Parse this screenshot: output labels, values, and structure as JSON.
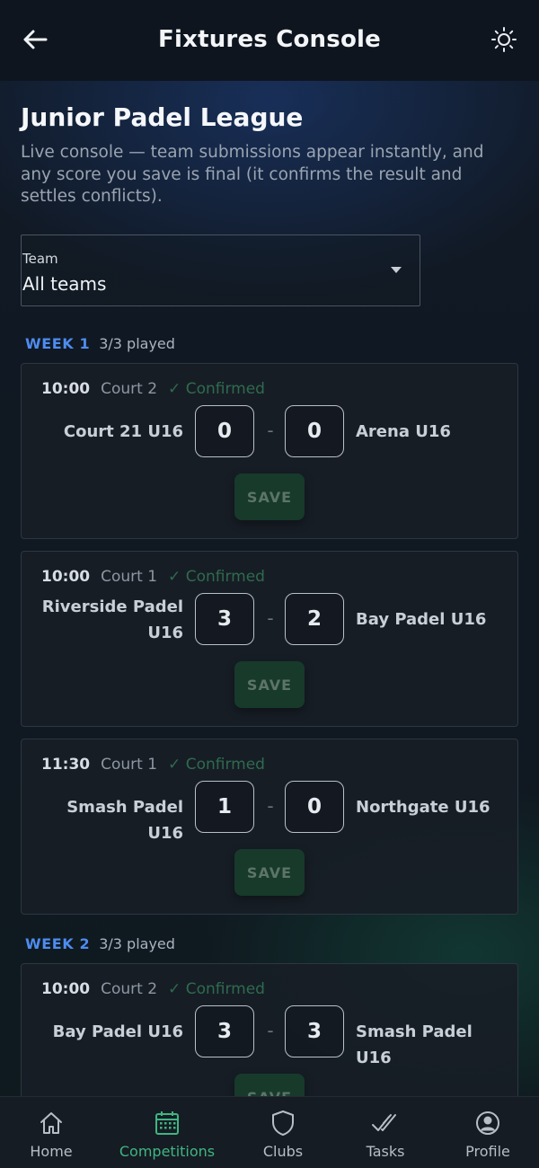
{
  "header": {
    "title": "Fixtures Console"
  },
  "league": {
    "title": "Junior Padel League",
    "description": "Live console — team submissions appear instantly, and any score you save is final (it confirms the result and settles conflicts)."
  },
  "team_filter": {
    "label": "Team",
    "value": "All teams"
  },
  "weeks": [
    {
      "label": "WEEK 1",
      "played": "3/3 played"
    },
    {
      "label": "WEEK 2",
      "played": "3/3 played"
    }
  ],
  "fixtures": [
    {
      "time": "10:00",
      "court": "Court 2",
      "status": "✓ Confirmed",
      "home": "Court 21 U16",
      "home_score": "0",
      "away_score": "0",
      "away": "Arena U16",
      "save": "SAVE"
    },
    {
      "time": "10:00",
      "court": "Court 1",
      "status": "✓ Confirmed",
      "home": "Riverside Padel U16",
      "home_score": "3",
      "away_score": "2",
      "away": "Bay Padel U16",
      "save": "SAVE"
    },
    {
      "time": "11:30",
      "court": "Court 1",
      "status": "✓ Confirmed",
      "home": "Smash Padel U16",
      "home_score": "1",
      "away_score": "0",
      "away": "Northgate U16",
      "save": "SAVE"
    },
    {
      "time": "10:00",
      "court": "Court 2",
      "status": "✓ Confirmed",
      "home": "Bay Padel U16",
      "home_score": "3",
      "away_score": "3",
      "away": "Smash Padel U16",
      "save": "SAVE"
    }
  ],
  "score_separator": "-",
  "nav": [
    {
      "label": "Home",
      "icon": "home-icon"
    },
    {
      "label": "Competitions",
      "icon": "calendar-icon",
      "active": true
    },
    {
      "label": "Clubs",
      "icon": "shield-icon"
    },
    {
      "label": "Tasks",
      "icon": "double-check-icon"
    },
    {
      "label": "Profile",
      "icon": "user-circle-icon"
    }
  ],
  "colors": {
    "accent_blue": "#4e8cf0",
    "accent_green": "#3fb583",
    "confirmed": "#2f6b4e"
  }
}
